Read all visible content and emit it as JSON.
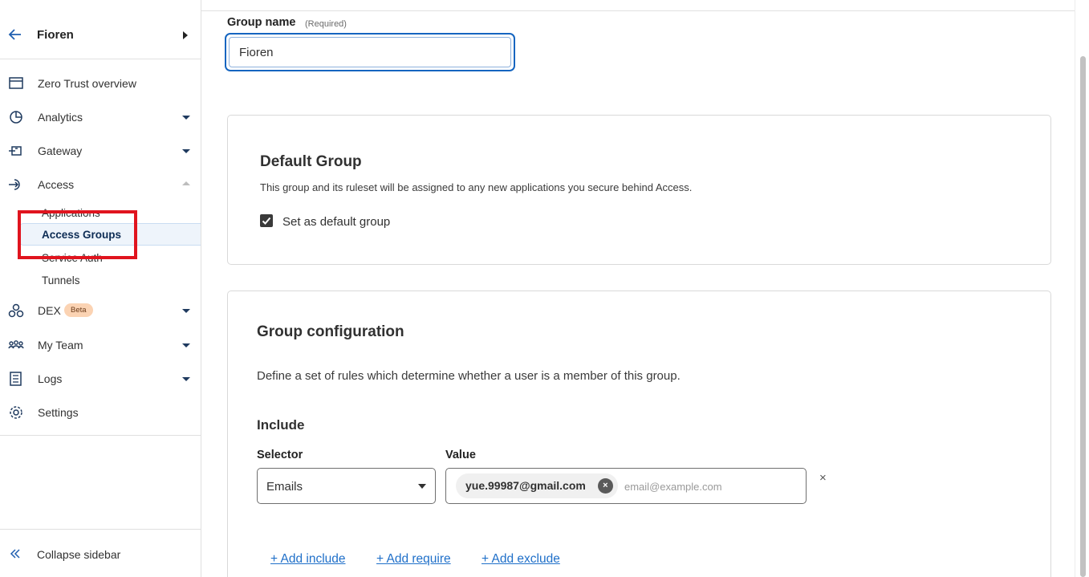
{
  "sidebar": {
    "account": {
      "name": "Fioren"
    },
    "items": [
      {
        "label": "Zero Trust overview",
        "icon": "browser-window-icon"
      },
      {
        "label": "Analytics",
        "icon": "pie-chart-icon"
      },
      {
        "label": "Gateway",
        "icon": "gateway-icon"
      },
      {
        "label": "Access",
        "icon": "access-icon"
      },
      {
        "label": "DEX",
        "icon": "dex-icon",
        "badge": "Beta"
      },
      {
        "label": "My Team",
        "icon": "team-icon"
      },
      {
        "label": "Logs",
        "icon": "logs-icon"
      },
      {
        "label": "Settings",
        "icon": "gear-icon"
      }
    ],
    "access_sub": [
      "Applications",
      "Access Groups",
      "Service Auth",
      "Tunnels"
    ],
    "collapse_label": "Collapse sidebar"
  },
  "form": {
    "group_name_label": "Group name",
    "required_label": "(Required)",
    "group_name_value": "Fioren"
  },
  "default_group": {
    "title": "Default Group",
    "description": "This group and its ruleset will be assigned to any new applications you secure behind Access.",
    "checkbox_label": "Set as default group",
    "checked": true
  },
  "group_config": {
    "title": "Group configuration",
    "description": "Define a set of rules which determine whether a user is a member of this group.",
    "include_heading": "Include",
    "selector_label": "Selector",
    "value_label": "Value",
    "selector_value": "Emails",
    "chip_email": "yue.99987@gmail.com",
    "value_placeholder": "email@example.com",
    "links": {
      "include": "+ Add include",
      "require": "+ Add require",
      "exclude": "+ Add exclude"
    }
  },
  "colors": {
    "accent": "#1565c0",
    "link": "#2070c9",
    "highlight": "#e0141e",
    "beta_badge": "#fbd3b3"
  }
}
